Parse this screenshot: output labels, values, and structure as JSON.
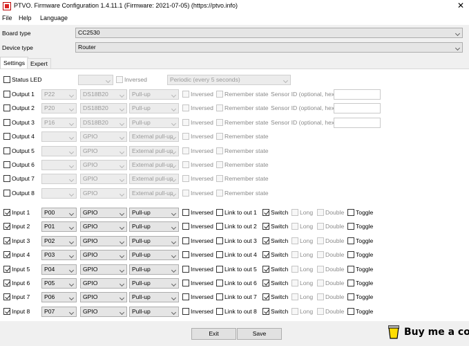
{
  "window": {
    "title": "PTVO. Firmware Configuration 1.4.11.1 (Firmware: 2021-07-05) (https://ptvo.info)",
    "close": "✕"
  },
  "menu": [
    "File",
    "Help",
    "Language"
  ],
  "board_type": {
    "label": "Board type",
    "value": "CC2530"
  },
  "device_type": {
    "label": "Device type",
    "value": "Router"
  },
  "tabs": [
    "Settings",
    "Expert"
  ],
  "status_led": {
    "label": "Status LED",
    "pin": "",
    "inversed": "Inversed",
    "mode": "Periodic (every 5 seconds)"
  },
  "outputs": [
    {
      "label": "Output 1",
      "pin": "P22",
      "type": "DS18B20",
      "pull": "Pull-up",
      "inversed": "Inversed",
      "remember": "Remember state",
      "sensor": "Sensor ID (optional, hex)"
    },
    {
      "label": "Output 2",
      "pin": "P20",
      "type": "DS18B20",
      "pull": "Pull-up",
      "inversed": "Inversed",
      "remember": "Remember state",
      "sensor": "Sensor ID (optional, hex)"
    },
    {
      "label": "Output 3",
      "pin": "P16",
      "type": "DS18B20",
      "pull": "Pull-up",
      "inversed": "Inversed",
      "remember": "Remember state",
      "sensor": "Sensor ID (optional, hex)"
    },
    {
      "label": "Output 4",
      "pin": "",
      "type": "GPIO",
      "pull": "External pull-up",
      "inversed": "Inversed",
      "remember": "Remember state"
    },
    {
      "label": "Output 5",
      "pin": "",
      "type": "GPIO",
      "pull": "External pull-up",
      "inversed": "Inversed",
      "remember": "Remember state"
    },
    {
      "label": "Output 6",
      "pin": "",
      "type": "GPIO",
      "pull": "External pull-up",
      "inversed": "Inversed",
      "remember": "Remember state"
    },
    {
      "label": "Output 7",
      "pin": "",
      "type": "GPIO",
      "pull": "External pull-up",
      "inversed": "Inversed",
      "remember": "Remember state"
    },
    {
      "label": "Output 8",
      "pin": "",
      "type": "GPIO",
      "pull": "External pull-up",
      "inversed": "Inversed",
      "remember": "Remember state"
    }
  ],
  "inputs": [
    {
      "label": "Input 1",
      "pin": "P00",
      "type": "GPIO",
      "pull": "Pull-up",
      "inversed": "Inversed",
      "link": "Link to out 1",
      "switch": "Switch",
      "long": "Long",
      "double": "Double",
      "toggle": "Toggle"
    },
    {
      "label": "Input 2",
      "pin": "P01",
      "type": "GPIO",
      "pull": "Pull-up",
      "inversed": "Inversed",
      "link": "Link to out 2",
      "switch": "Switch",
      "long": "Long",
      "double": "Double",
      "toggle": "Toggle"
    },
    {
      "label": "Input 3",
      "pin": "P02",
      "type": "GPIO",
      "pull": "Pull-up",
      "inversed": "Inversed",
      "link": "Link to out 3",
      "switch": "Switch",
      "long": "Long",
      "double": "Double",
      "toggle": "Toggle"
    },
    {
      "label": "Input 4",
      "pin": "P03",
      "type": "GPIO",
      "pull": "Pull-up",
      "inversed": "Inversed",
      "link": "Link to out 4",
      "switch": "Switch",
      "long": "Long",
      "double": "Double",
      "toggle": "Toggle"
    },
    {
      "label": "Input 5",
      "pin": "P04",
      "type": "GPIO",
      "pull": "Pull-up",
      "inversed": "Inversed",
      "link": "Link to out 5",
      "switch": "Switch",
      "long": "Long",
      "double": "Double",
      "toggle": "Toggle"
    },
    {
      "label": "Input 6",
      "pin": "P05",
      "type": "GPIO",
      "pull": "Pull-up",
      "inversed": "Inversed",
      "link": "Link to out 6",
      "switch": "Switch",
      "long": "Long",
      "double": "Double",
      "toggle": "Toggle"
    },
    {
      "label": "Input 7",
      "pin": "P06",
      "type": "GPIO",
      "pull": "Pull-up",
      "inversed": "Inversed",
      "link": "Link to out 7",
      "switch": "Switch",
      "long": "Long",
      "double": "Double",
      "toggle": "Toggle"
    },
    {
      "label": "Input 8",
      "pin": "P07",
      "type": "GPIO",
      "pull": "Pull-up",
      "inversed": "Inversed",
      "link": "Link to out 8",
      "switch": "Switch",
      "long": "Long",
      "double": "Double",
      "toggle": "Toggle"
    }
  ],
  "buttons": {
    "exit": "Exit",
    "save": "Save"
  },
  "coffee": {
    "text": "Buy me a coffee",
    "cup_color": "#ffdd00"
  }
}
